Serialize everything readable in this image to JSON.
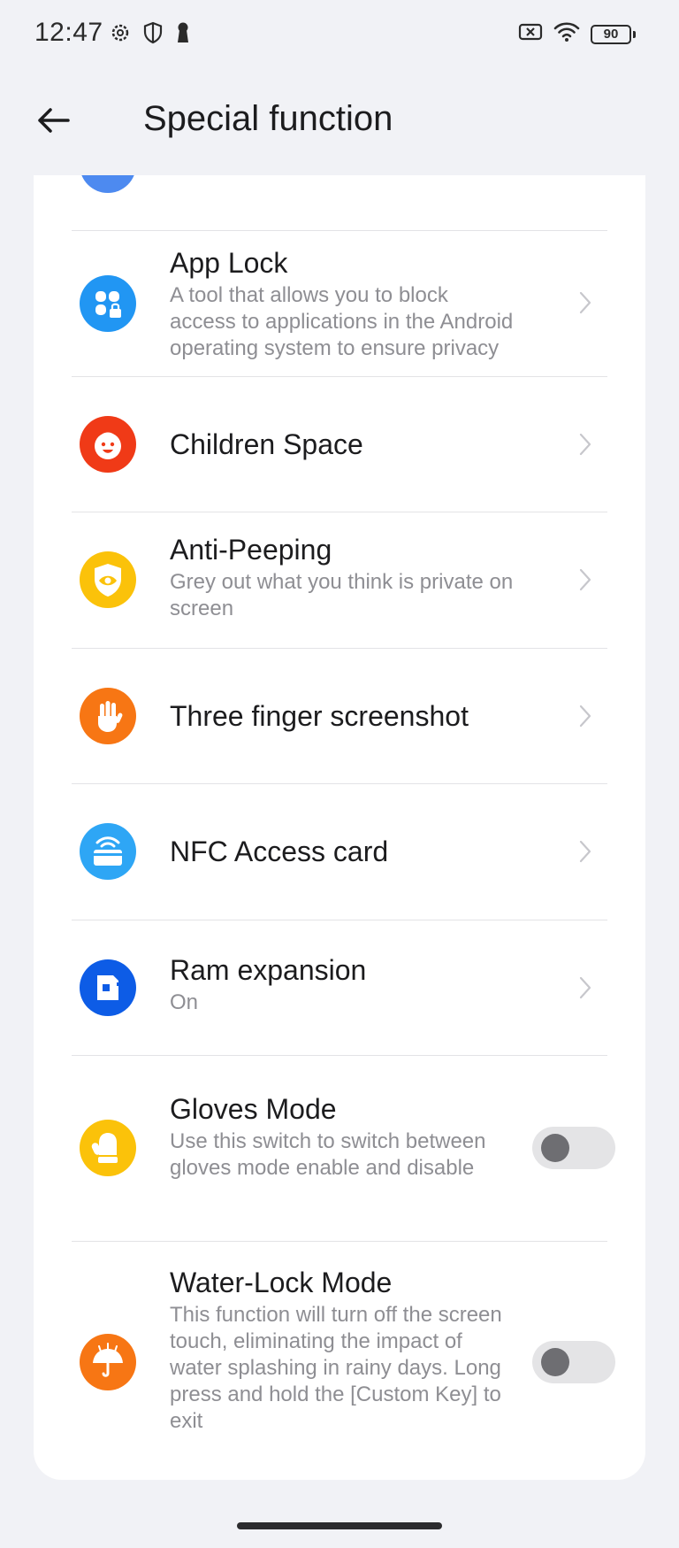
{
  "status_bar": {
    "time": "12:47",
    "battery": "90",
    "left_icons": [
      "gear-icon",
      "shield-icon",
      "keyhole-icon"
    ],
    "right_icons": [
      "sim-off-icon",
      "wifi-icon",
      "battery-icon"
    ]
  },
  "header": {
    "title": "Special function"
  },
  "items": [
    {
      "title": "App Lock",
      "description": "A tool that allows you to block access to applications in the Android operating system to ensure privacy",
      "icon": "app-lock-icon",
      "color": "#2196f3",
      "control": "chevron"
    },
    {
      "title": "Children Space",
      "description": "",
      "icon": "child-face-icon",
      "color": "#f03a17",
      "control": "chevron"
    },
    {
      "title": "Anti-Peeping",
      "description": "Grey out what you think is private on screen",
      "icon": "eye-shield-icon",
      "color": "#fbc20a",
      "control": "chevron"
    },
    {
      "title": "Three finger screenshot",
      "description": "",
      "icon": "hand-icon",
      "color": "#f77614",
      "control": "chevron"
    },
    {
      "title": "NFC Access card",
      "description": "",
      "icon": "nfc-card-icon",
      "color": "#2ea6f5",
      "control": "chevron"
    },
    {
      "title": "Ram expansion",
      "description": "On",
      "icon": "ram-chip-icon",
      "color": "#0d5ce6",
      "control": "chevron"
    },
    {
      "title": "Gloves Mode",
      "description": "Use this switch to switch between gloves mode enable and disable",
      "icon": "glove-icon",
      "color": "#fbc20a",
      "control": "toggle",
      "enabled": false
    },
    {
      "title": "Water-Lock Mode",
      "description": "This function will turn off the screen touch, eliminating the impact of water splashing in rainy days. Long press and hold the [Custom Key] to exit",
      "icon": "umbrella-icon",
      "color": "#f77614",
      "control": "toggle",
      "enabled": false
    }
  ]
}
